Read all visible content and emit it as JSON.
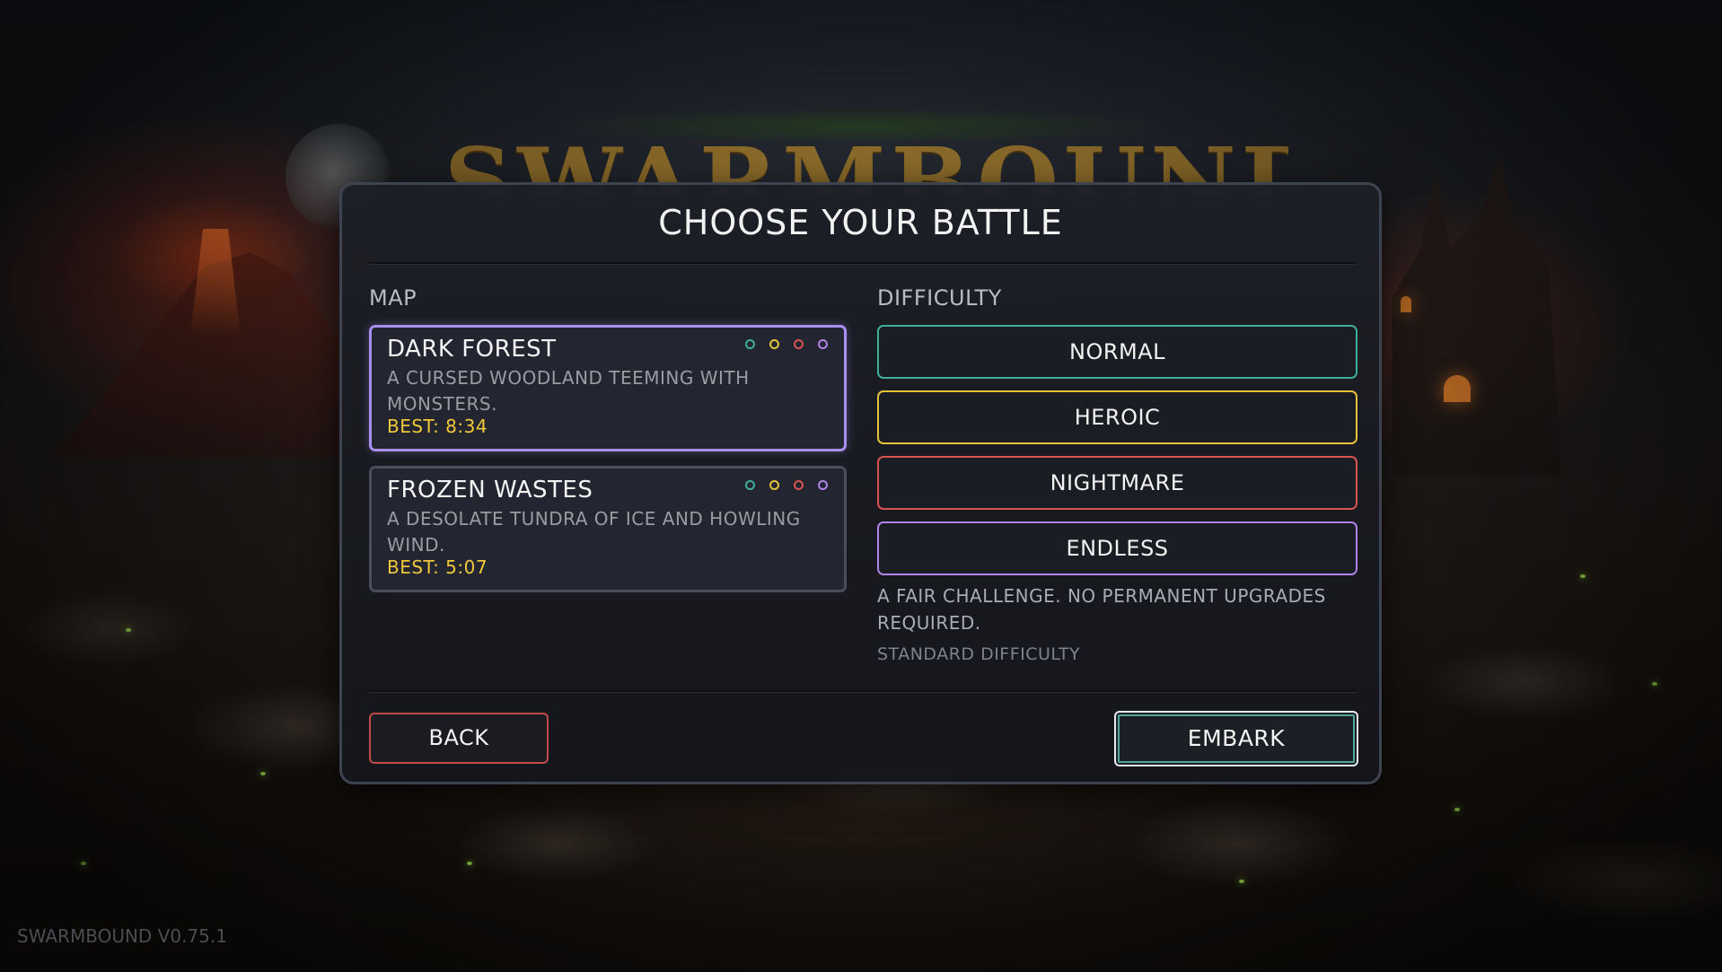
{
  "game": {
    "logo_text": "SWARMBOUND",
    "version": "SWARMBOUND V0.75.1"
  },
  "modal": {
    "title": "CHOOSE YOUR BATTLE",
    "map_label": "MAP",
    "difficulty_label": "DIFFICULTY"
  },
  "maps": [
    {
      "name": "DARK FOREST",
      "description": "A CURSED WOODLAND TEEMING WITH MONSTERS.",
      "best": "BEST: 8:34",
      "selected": true
    },
    {
      "name": "FROZEN WASTES",
      "description": "A DESOLATE TUNDRA OF ICE AND HOWLING WIND.",
      "best": "BEST: 5:07",
      "selected": false
    }
  ],
  "difficulty_colors": {
    "normal": "#3fae9c",
    "heroic": "#e6c23a",
    "nightmare": "#d9534f",
    "endless": "#b083e8"
  },
  "difficulties": [
    {
      "key": "normal",
      "label": "NORMAL"
    },
    {
      "key": "heroic",
      "label": "HEROIC"
    },
    {
      "key": "nightmare",
      "label": "NIGHTMARE"
    },
    {
      "key": "endless",
      "label": "ENDLESS"
    }
  ],
  "difficulty_info": {
    "description": "A FAIR CHALLENGE. NO PERMANENT UPGRADES REQUIRED.",
    "subtext": "STANDARD DIFFICULTY"
  },
  "actions": {
    "back_label": "BACK",
    "embark_label": "EMBARK"
  },
  "colors": {
    "selected_border": "#a98ff0",
    "best_time": "#f0c839",
    "back_border": "#c24a48",
    "embark_inner": "#4fa79b"
  }
}
